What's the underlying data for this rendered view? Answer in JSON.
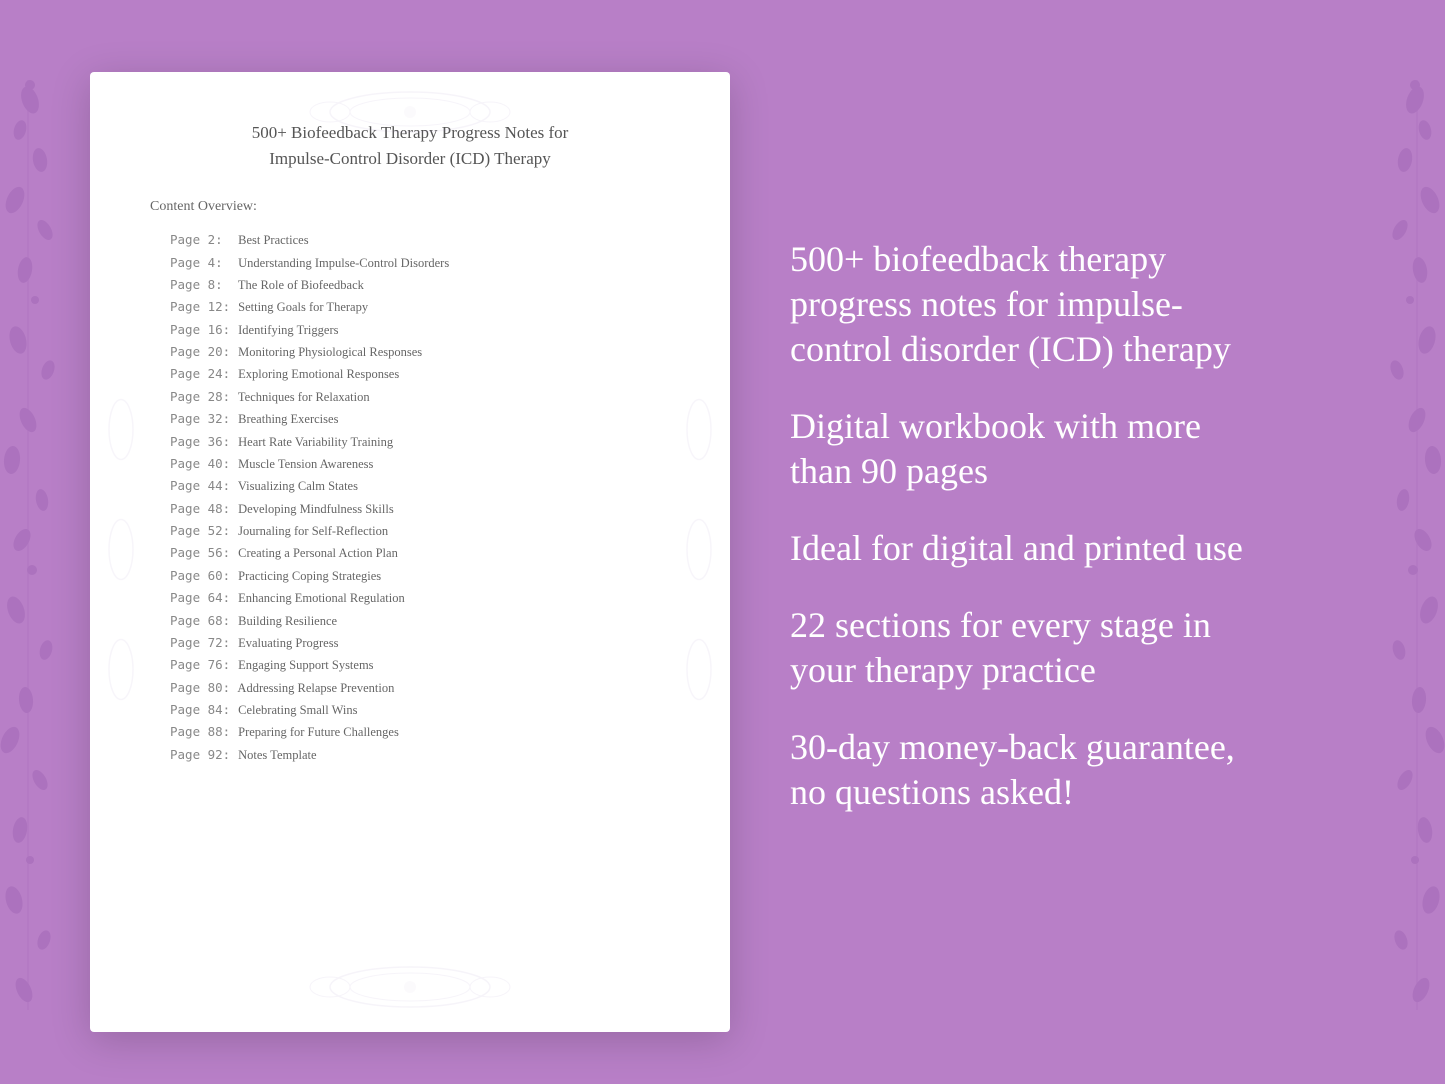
{
  "background": {
    "color": "#b87fc7"
  },
  "document": {
    "title_line1": "500+ Biofeedback Therapy Progress Notes for",
    "title_line2": "Impulse-Control Disorder (ICD) Therapy",
    "content_overview_label": "Content Overview:",
    "toc": [
      {
        "page": "Page  2:",
        "topic": "Best Practices"
      },
      {
        "page": "Page  4:",
        "topic": "Understanding Impulse-Control Disorders"
      },
      {
        "page": "Page  8:",
        "topic": "The Role of Biofeedback"
      },
      {
        "page": "Page 12:",
        "topic": "Setting Goals for Therapy"
      },
      {
        "page": "Page 16:",
        "topic": "Identifying Triggers"
      },
      {
        "page": "Page 20:",
        "topic": "Monitoring Physiological Responses"
      },
      {
        "page": "Page 24:",
        "topic": "Exploring Emotional Responses"
      },
      {
        "page": "Page 28:",
        "topic": "Techniques for Relaxation"
      },
      {
        "page": "Page 32:",
        "topic": "Breathing Exercises"
      },
      {
        "page": "Page 36:",
        "topic": "Heart Rate Variability Training"
      },
      {
        "page": "Page 40:",
        "topic": "Muscle Tension Awareness"
      },
      {
        "page": "Page 44:",
        "topic": "Visualizing Calm States"
      },
      {
        "page": "Page 48:",
        "topic": "Developing Mindfulness Skills"
      },
      {
        "page": "Page 52:",
        "topic": "Journaling for Self-Reflection"
      },
      {
        "page": "Page 56:",
        "topic": "Creating a Personal Action Plan"
      },
      {
        "page": "Page 60:",
        "topic": "Practicing Coping Strategies"
      },
      {
        "page": "Page 64:",
        "topic": "Enhancing Emotional Regulation"
      },
      {
        "page": "Page 68:",
        "topic": "Building Resilience"
      },
      {
        "page": "Page 72:",
        "topic": "Evaluating Progress"
      },
      {
        "page": "Page 76:",
        "topic": "Engaging Support Systems"
      },
      {
        "page": "Page 80:",
        "topic": "Addressing Relapse Prevention"
      },
      {
        "page": "Page 84:",
        "topic": "Celebrating Small Wins"
      },
      {
        "page": "Page 88:",
        "topic": "Preparing for Future Challenges"
      },
      {
        "page": "Page 92:",
        "topic": "Notes Template"
      }
    ]
  },
  "features": [
    {
      "id": "feature-1",
      "text": "500+ biofeedback therapy progress notes for impulse-control disorder (ICD) therapy"
    },
    {
      "id": "feature-2",
      "text": "Digital workbook with more than 90 pages"
    },
    {
      "id": "feature-3",
      "text": "Ideal for digital and printed use"
    },
    {
      "id": "feature-4",
      "text": "22 sections for every stage in your therapy practice"
    },
    {
      "id": "feature-5",
      "text": "30-day money-back guarantee, no questions asked!"
    }
  ]
}
